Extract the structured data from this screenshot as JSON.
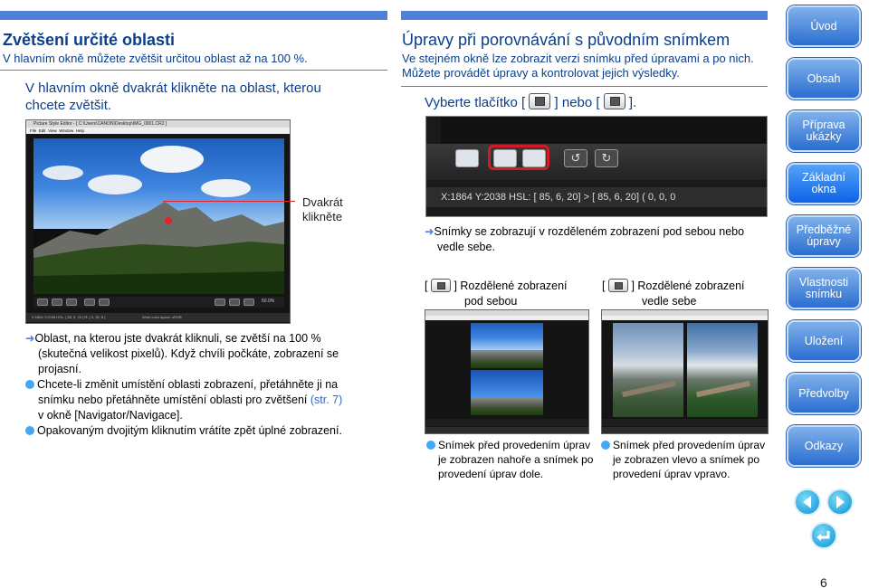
{
  "left": {
    "title": "Zvětšení určité oblasti",
    "subtitle": "V hlavním okně můžete zvětšit určitou oblast až na 100 %.",
    "step_line1": "V hlavním okně dvakrát klikněte na oblast, kterou",
    "step_line2": "chcete zvětšit.",
    "callout_line1": "Dvakrát",
    "callout_line2": "klikněte",
    "screenshot": {
      "window_title": "Picture Style Editor - [ C:\\Users\\CANON\\Desktop\\IMG_0001.CR2 ]",
      "menu": [
        "File",
        "Edit",
        "View",
        "Window",
        "Help"
      ],
      "zoom": "50.0%",
      "status_left": "X:1864 Y:2038  HSL: [ 85, 6, 20 ]  R: [ 5, 36, 8 ]",
      "status_right": "Work color space: sRGB"
    },
    "note1_line1": "Oblast, na kterou jste dvakrát kliknuli, se zvětší na 100 %",
    "note1_line2": "(skutečná velikost pixelů). Když chvíli počkáte, zobrazení se",
    "note1_line3": "projasní.",
    "note2_line1": "Chcete-li změnit umístění oblasti zobrazení, přetáhněte ji na",
    "note2_line2a": "snímku nebo přetáhněte umístění oblasti pro zvětšení ",
    "note2_link": "(str. 7)",
    "note2_line3": "v okně [Navigator/Navigace].",
    "note3": "Opakovaným dvojitým kliknutím vrátíte zpět úplné zobrazení."
  },
  "right": {
    "title": "Úpravy při porovnávání s původním snímkem",
    "sub_line1": "Ve stejném okně lze zobrazit verzi snímku před úpravami a po nich.",
    "sub_line2": "Můžete provádět úpravy a kontrolovat jejich výsledky.",
    "step_prefix": "Vyberte tlačítko [",
    "step_mid": "] nebo [",
    "step_suffix": "].",
    "toolbar_status": "X:1864 Y:2038 HSL: [ 85, 6, 20] > [ 85, 6, 20]  ( 0, 0, 0",
    "result_line1": "Snímky se zobrazují v rozděleném zobrazení pod sebou nebo",
    "result_line2": "vedle sebe.",
    "split_v_label1": "] Rozdělené zobrazení",
    "split_v_label2": "pod sebou",
    "split_h_label1": "] Rozdělené zobrazení",
    "split_h_label2": "vedle sebe",
    "bracket_open": "[",
    "cap1_line1": "Snímek před provedením úprav",
    "cap1_line2": "je zobrazen nahoře a snímek po",
    "cap1_line3": "provedení úprav dole.",
    "cap2_line1": "Snímek před provedením úprav",
    "cap2_line2": "je zobrazen vlevo a snímek po",
    "cap2_line3": "provedení úprav vpravo."
  },
  "nav": {
    "items": [
      "Úvod",
      "Obsah",
      "Příprava ukázky",
      "Základní okna",
      "Předběžné úpravy",
      "Vlastnosti snímku",
      "Uložení",
      "Předvolby",
      "Odkazy"
    ],
    "active_index": 3,
    "page_number": "6"
  },
  "colors": {
    "heading": "#0a3f8c",
    "accent": "#4f7fd6",
    "nav": "#2a6ed1",
    "bullet": "#43a7f2"
  }
}
